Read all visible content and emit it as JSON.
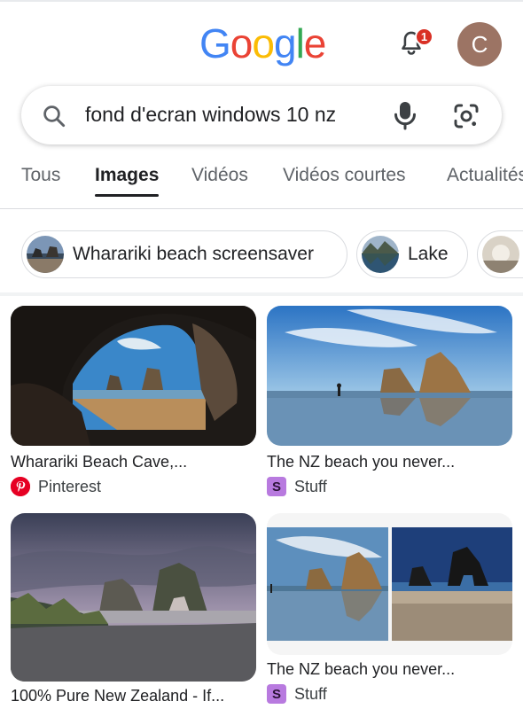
{
  "header": {
    "logo_letters": [
      "G",
      "o",
      "o",
      "g",
      "l",
      "e"
    ],
    "logo_colors": [
      "#4285F4",
      "#EA4335",
      "#FBBC05",
      "#4285F4",
      "#34A853",
      "#EA4335"
    ],
    "notification_count": "1",
    "avatar_initial": "C",
    "avatar_color": "#9c7464"
  },
  "search": {
    "query": "fond d'ecran windows 10 nz"
  },
  "tabs": [
    {
      "label": "Tous",
      "active": false
    },
    {
      "label": "Images",
      "active": true
    },
    {
      "label": "Vidéos",
      "active": false
    },
    {
      "label": "Vidéos courtes",
      "active": false
    },
    {
      "label": "Actualités",
      "active": false
    }
  ],
  "chips": [
    {
      "label": "Wharariki beach screensaver"
    },
    {
      "label": "Lake"
    },
    {
      "label": ""
    }
  ],
  "results": [
    {
      "title": "Wharariki Beach Cave,...",
      "source": "Pinterest",
      "source_icon": "pinterest-icon"
    },
    {
      "title": "The NZ beach you never...",
      "source": "Stuff",
      "source_icon": "stuff-icon",
      "source_glyph": "S"
    },
    {
      "title": "100% Pure New Zealand - If...",
      "source": "",
      "source_icon": ""
    },
    {
      "title": "The NZ beach you never...",
      "source": "Stuff",
      "source_icon": "stuff-icon",
      "source_glyph": "S"
    }
  ],
  "colors": {
    "accent_underline": "#202124",
    "badge": "#d93025",
    "pinterest": "#e60023",
    "stuff": "#b87adf"
  }
}
